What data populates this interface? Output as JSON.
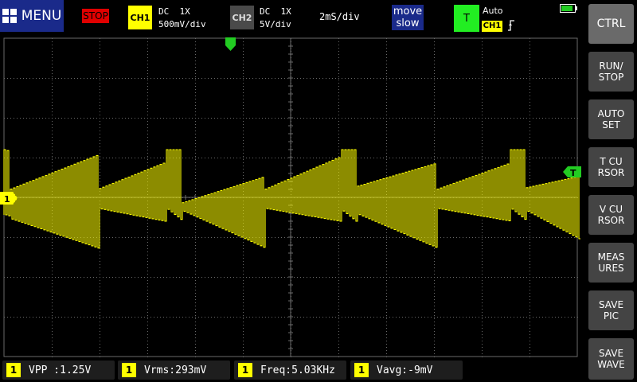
{
  "top_bar": {
    "menu_label": "MENU",
    "run_state": "STOP",
    "ch1": {
      "tag": "CH1",
      "coupling": "DC  1X",
      "scale": "500mV/div"
    },
    "ch2": {
      "tag": "CH2",
      "coupling": "DC  1X",
      "scale": "5V/div"
    },
    "timebase": "2mS/div",
    "move_line1": "move",
    "move_line2": "slow",
    "trigger": {
      "tag": "T",
      "mode": "Auto",
      "source": "CH1",
      "edge_icon": "rising-edge-icon"
    },
    "battery_level": 0.9
  },
  "scope": {
    "channel_marker": "1",
    "trigger_marker": "T",
    "trace_color": "#ffff00",
    "grid_color": "#6a6a6a",
    "trigger_pos_color": "#22cc22"
  },
  "side_buttons": [
    {
      "id": "ctrl",
      "label": "CTRL"
    },
    {
      "id": "run-stop",
      "label": "RUN/\nSTOP"
    },
    {
      "id": "auto-set",
      "label": "AUTO\nSET"
    },
    {
      "id": "t-cursor",
      "label": "T CU\nRSOR"
    },
    {
      "id": "v-cursor",
      "label": "V CU\nRSOR"
    },
    {
      "id": "measures",
      "label": "MEAS\nURES"
    },
    {
      "id": "save-pic",
      "label": "SAVE\nPIC"
    },
    {
      "id": "save-wave",
      "label": "SAVE\nWAVE"
    }
  ],
  "measurements": [
    {
      "ch": "1",
      "text": "VPP :1.25V"
    },
    {
      "ch": "1",
      "text": "Vrms:293mV"
    },
    {
      "ch": "1",
      "text": "Freq:5.03KHz"
    },
    {
      "ch": "1",
      "text": "Vavg:-9mV"
    }
  ]
}
